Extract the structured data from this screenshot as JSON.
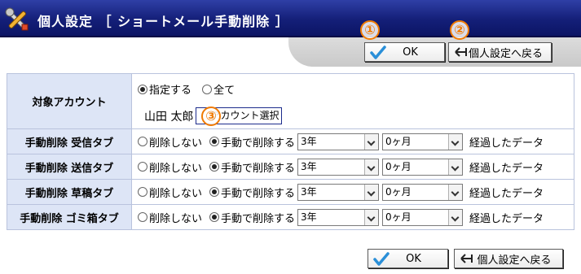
{
  "header": {
    "title": "個人設定 ［ ショートメール手動削除 ］",
    "icon": "tools-icon"
  },
  "buttons": {
    "ok_label": "OK",
    "back_label": "個人設定へ戻る",
    "ok_icon": "checkmark-icon",
    "back_icon": "back-arrow-icon"
  },
  "callouts": [
    "①",
    "②",
    "③"
  ],
  "target_account": {
    "header": "対象アカウント",
    "options": [
      "指定する",
      "全て"
    ],
    "selected": "指定する",
    "user_name": "山田 太郎",
    "select_button": "アカウント選択"
  },
  "rows": [
    {
      "label": "手動削除 受信タブ",
      "no_delete": "削除しない",
      "manual": "手動で削除する",
      "selected": "手動で削除する",
      "year": "3年",
      "month": "0ヶ月",
      "suffix": "経過したデータ"
    },
    {
      "label": "手動削除 送信タブ",
      "no_delete": "削除しない",
      "manual": "手動で削除する",
      "selected": "手動で削除する",
      "year": "3年",
      "month": "0ヶ月",
      "suffix": "経過したデータ"
    },
    {
      "label": "手動削除 草稿タブ",
      "no_delete": "削除しない",
      "manual": "手動で削除する",
      "selected": "手動で削除する",
      "year": "3年",
      "month": "0ヶ月",
      "suffix": "経過したデータ"
    },
    {
      "label": "手動削除 ゴミ箱タブ",
      "no_delete": "削除しない",
      "manual": "手動で削除する",
      "selected": "手動で削除する",
      "year": "3年",
      "month": "0ヶ月",
      "suffix": "経過したデータ"
    }
  ],
  "colors": {
    "header_bg": "#141f78",
    "label_cell_bg": "#dde5f6",
    "callout": "#f07a00",
    "ok_check": "#2a8fd8"
  }
}
